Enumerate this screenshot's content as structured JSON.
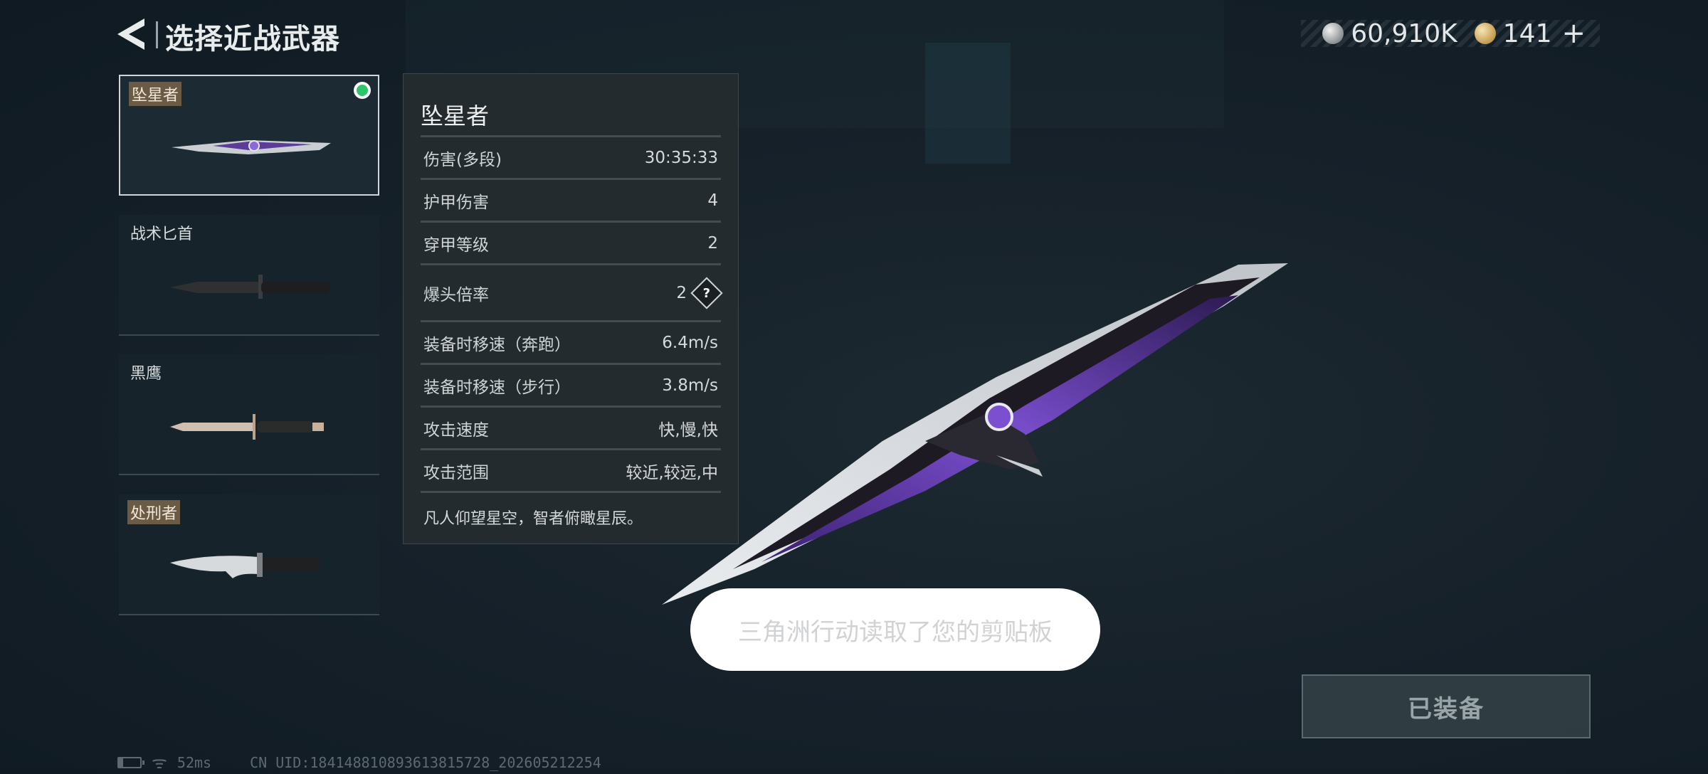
{
  "header": {
    "title": "选择近战武器"
  },
  "currency": [
    {
      "icon": "silver-coin-icon",
      "value": "60,910K"
    },
    {
      "icon": "gold-coin-icon",
      "value": "141"
    }
  ],
  "currency_add_label": "+",
  "weapons": [
    {
      "name": "坠星者",
      "tagged": true,
      "selected": true,
      "equipped": true
    },
    {
      "name": "战术匕首",
      "tagged": false,
      "selected": false,
      "equipped": false
    },
    {
      "name": "黑鹰",
      "tagged": false,
      "selected": false,
      "equipped": false
    },
    {
      "name": "处刑者",
      "tagged": true,
      "selected": false,
      "equipped": false
    }
  ],
  "stats": {
    "title": "坠星者",
    "rows": [
      {
        "label": "伤害(多段)",
        "value": "30:35:33"
      },
      {
        "label": "护甲伤害",
        "value": "4"
      },
      {
        "label": "穿甲等级",
        "value": "2"
      },
      {
        "label": "爆头倍率",
        "value": "2",
        "help": "?"
      },
      {
        "label": "装备时移速（奔跑）",
        "value": "6.4m/s"
      },
      {
        "label": "装备时移速（步行）",
        "value": "3.8m/s"
      },
      {
        "label": "攻击速度",
        "value": "快,慢,快"
      },
      {
        "label": "攻击范围",
        "value": "较近,较远,中"
      }
    ],
    "description": "凡人仰望星空，智者俯瞰星辰。"
  },
  "toast": {
    "text": "三角洲行动读取了您的剪贴板"
  },
  "equip_button": {
    "label": "已装备"
  },
  "footer": {
    "ping": "52ms",
    "uid": "CN UID:1841488108936138157​28_202605212254"
  },
  "colors": {
    "equipped_dot": "#2ec66a",
    "knife_accent": "#7b4fd0"
  }
}
